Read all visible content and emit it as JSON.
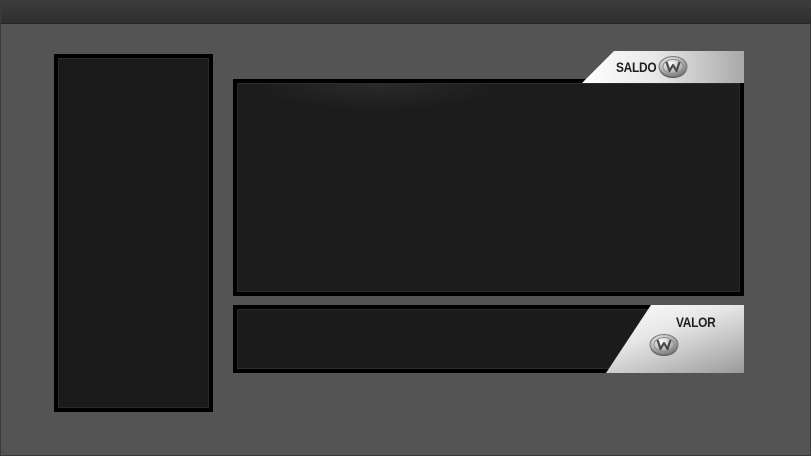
{
  "balance": {
    "label": "SALDO",
    "coin_icon": "w-coin-icon"
  },
  "amount": {
    "label": "VALOR",
    "coin_icon": "w-coin-icon"
  },
  "colors": {
    "background": "#545454",
    "panel": "#1b1b1b",
    "panel_border": "#000000",
    "tab_light": "#ffffff",
    "tab_dark": "#a9a9a9",
    "label_text": "#1e1e1e"
  }
}
